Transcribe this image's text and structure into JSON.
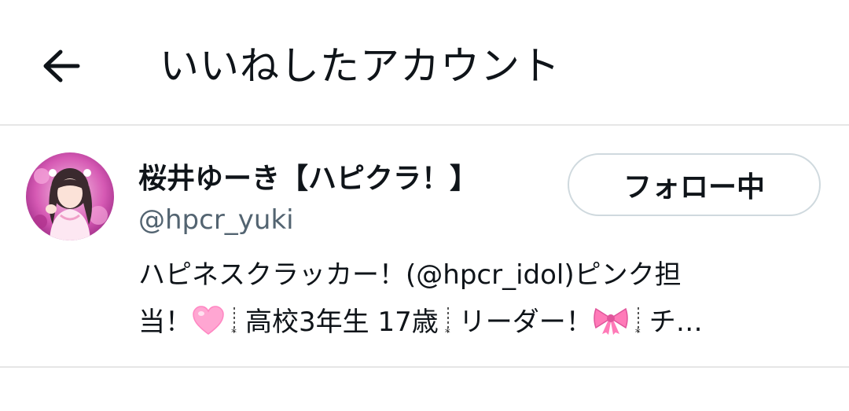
{
  "header": {
    "back_icon": "arrow-left-icon",
    "title": "いいねしたアカウント"
  },
  "user": {
    "display_name": "桜井ゆーき【ハピクラ！】",
    "handle": "@hpcr_yuki",
    "follow_label": "フォロー中",
    "avatar_icon": "profile-photo",
    "bio": {
      "line1_prefix": "ハピネスクラッカー！(",
      "mention": "@hpcr_idol",
      "line1_suffix": ")ピンク担",
      "line2_a": "当！",
      "line2_b": "高校3年生 17歳",
      "line2_c": "リーダー！",
      "line2_d": "チ…"
    }
  },
  "colors": {
    "text": "#0f1419",
    "secondary_text": "#536471",
    "divider": "#e6e6e6",
    "button_border": "#cfd9de",
    "accent_pink": "#ff9ccf"
  }
}
